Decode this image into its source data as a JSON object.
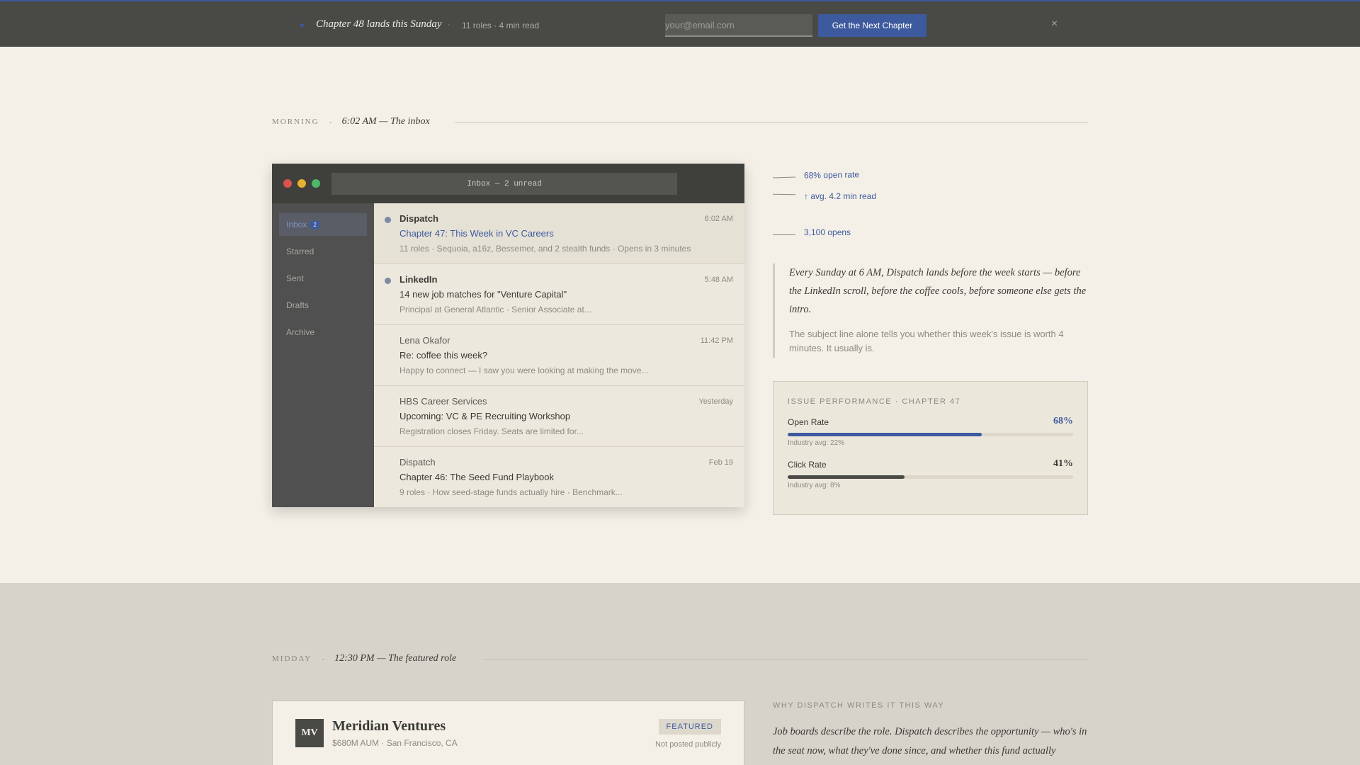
{
  "banner": {
    "title": "Chapter 48 lands this Sunday",
    "separator": "·",
    "meta": "11 roles · 4 min read",
    "email_placeholder": "your@email.com",
    "cta_label": "Get the Next Chapter",
    "close_glyph": "×",
    "accent_color": "#3d5a9e"
  },
  "morning": {
    "label": "MORNING",
    "dot": "·",
    "title": "6:02 AM — The inbox"
  },
  "inbox": {
    "address_bar": "Inbox — 2 unread",
    "sidebar": [
      {
        "label": "Inbox",
        "badge": "2"
      },
      {
        "label": "Starred"
      },
      {
        "label": "Sent"
      },
      {
        "label": "Drafts"
      },
      {
        "label": "Archive"
      }
    ],
    "emails": [
      {
        "from": "Dispatch",
        "time": "6:02 AM",
        "subject": "Chapter 47: This Week in VC Careers",
        "preview": "11 roles · Sequoia, a16z, Bessemer, and 2 stealth funds · Opens in 3 minutes",
        "unread": true
      },
      {
        "from": "LinkedIn",
        "time": "5:48 AM",
        "subject": "14 new job matches for \"Venture Capital\"",
        "preview": "Principal at General Atlantic · Senior Associate at...",
        "unread": true
      },
      {
        "from": "Lena Okafor",
        "time": "11:42 PM",
        "subject": "Re: coffee this week?",
        "preview": "Happy to connect — I saw you were looking at making the move...",
        "unread": false
      },
      {
        "from": "HBS Career Services",
        "time": "Yesterday",
        "subject": "Upcoming: VC & PE Recruiting Workshop",
        "preview": "Registration closes Friday. Seats are limited for...",
        "unread": false
      },
      {
        "from": "Dispatch",
        "time": "Feb 19",
        "subject": "Chapter 46: The Seed Fund Playbook",
        "preview": "9 roles · How seed-stage funds actually hire · Benchmark...",
        "unread": false
      }
    ]
  },
  "annotations": [
    "68% open rate",
    "↑ avg. 4.2 min read",
    "3,100 opens"
  ],
  "quote": {
    "main": "Every Sunday at 6 AM, Dispatch lands before the week starts — before the LinkedIn scroll, before the coffee cools, before someone else gets the intro.",
    "sub": "The subject line alone tells you whether this week's issue is worth 4 minutes. It usually is."
  },
  "performance": {
    "title": "ISSUE PERFORMANCE · CHAPTER 47",
    "metrics": [
      {
        "label": "Open Rate",
        "value": "68%",
        "fraction": 0.68,
        "avg": "Industry avg: 22%",
        "color": "#3d5a9e"
      },
      {
        "label": "Click Rate",
        "value": "41%",
        "fraction": 0.41,
        "avg": "Industry avg: 8%",
        "color": "#494946"
      }
    ]
  },
  "midday": {
    "label": "MIDDAY",
    "dot": "·",
    "title": "12:30 PM — The featured role"
  },
  "job": {
    "logo": "MV",
    "name": "Meridian Ventures",
    "meta": "$680M AUM · San Francisco, CA",
    "badge": "FEATURED",
    "note": "Not posted publicly"
  },
  "why": {
    "title": "WHY DISPATCH WRITES IT THIS WAY",
    "text": "Job boards describe the role. Dispatch describes the opportunity — who's in the seat now, what they've done since, and whether this fund actually"
  }
}
